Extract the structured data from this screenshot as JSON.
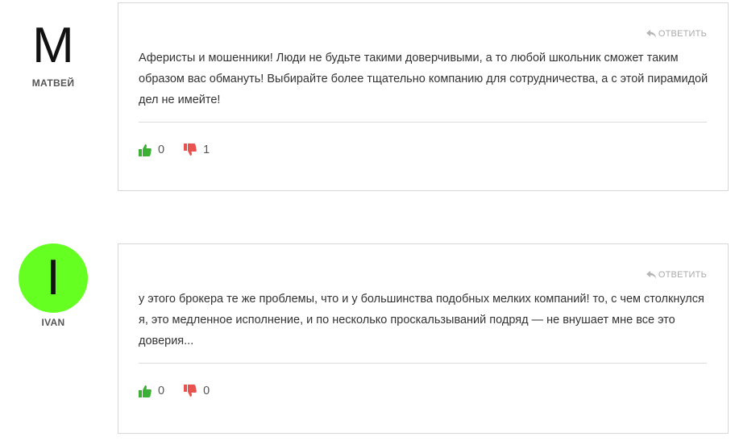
{
  "colors": {
    "like": "#3cb034",
    "dislike": "#e8524f",
    "avatar_ivan": "#66ff22"
  },
  "comments": [
    {
      "author": "МАТВЕЙ",
      "avatar_letter": "M",
      "reply_label": "ОТВЕТИТЬ",
      "text": "Аферисты и мошенники! Люди не будьте такими доверчивыми, а то любой школьник сможет таким образом вас обмануть! Выбирайте более тщательно компанию для сотрудничества, а с этой пирамидой дел не имейте!",
      "likes": "0",
      "dislikes": "1"
    },
    {
      "author": "IVAN",
      "avatar_letter": "I",
      "reply_label": "ОТВЕТИТЬ",
      "text": "у этого брокера те же проблемы, что и у большинства подобных мелких компаний! то, с чем столкнулся я, это медленное исполнение, и по несколько проскальзываний подряд — не внушает мне все это доверия...",
      "likes": "0",
      "dislikes": "0"
    }
  ]
}
